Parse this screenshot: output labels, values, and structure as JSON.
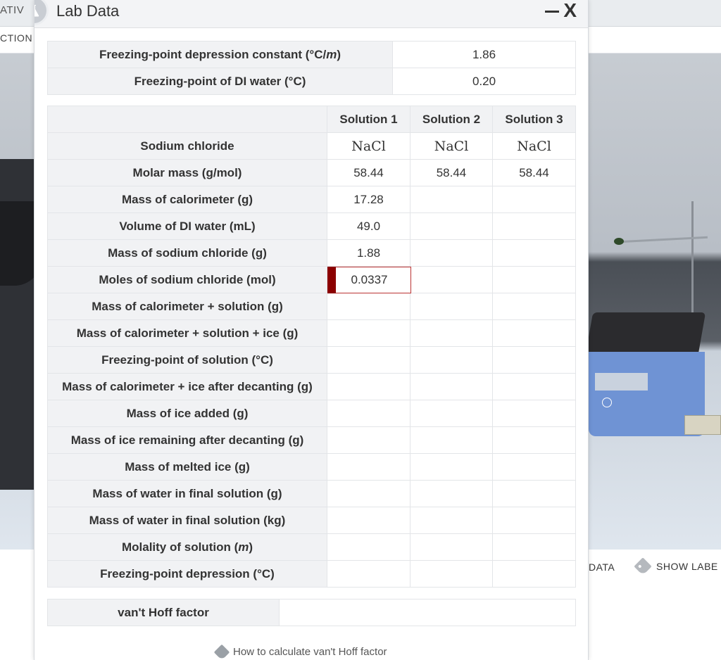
{
  "background": {
    "tab_fragment": "ATIV",
    "subtab_fragment": "CTION",
    "data_button": "DATA",
    "show_labels_button": "SHOW LABE"
  },
  "modal": {
    "title": "Lab Data",
    "close_label": "X",
    "icon": "flask-icon"
  },
  "constants": [
    {
      "label": "Freezing-point depression constant (°C/m)",
      "value": "1.86"
    },
    {
      "label": "Freezing-point of DI water (°C)",
      "value": "0.20"
    }
  ],
  "solutions_table": {
    "columns": [
      "Solution 1",
      "Solution 2",
      "Solution 3"
    ],
    "rows": [
      {
        "label": "Sodium chloride",
        "values": [
          "NaCl",
          "NaCl",
          "NaCl"
        ],
        "formula": true
      },
      {
        "label": "Molar mass (g/mol)",
        "values": [
          "58.44",
          "58.44",
          "58.44"
        ]
      },
      {
        "label": "Mass of calorimeter (g)",
        "values": [
          "17.28",
          "",
          ""
        ]
      },
      {
        "label": "Volume of DI water (mL)",
        "values": [
          "49.0",
          "",
          ""
        ]
      },
      {
        "label": "Mass of sodium chloride (g)",
        "values": [
          "1.88",
          "",
          ""
        ]
      },
      {
        "label": "Moles of sodium chloride (mol)",
        "values": [
          "0.0337",
          "",
          ""
        ],
        "active": true
      },
      {
        "label": "Mass of calorimeter + solution (g)",
        "values": [
          "",
          "",
          ""
        ]
      },
      {
        "label": "Mass of calorimeter + solution + ice (g)",
        "values": [
          "",
          "",
          ""
        ]
      },
      {
        "label": "Freezing-point of solution (°C)",
        "values": [
          "",
          "",
          ""
        ]
      },
      {
        "label": "Mass of calorimeter + ice after decanting (g)",
        "values": [
          "",
          "",
          ""
        ]
      },
      {
        "label": "Mass of ice added (g)",
        "values": [
          "",
          "",
          ""
        ]
      },
      {
        "label": "Mass of ice remaining after decanting (g)",
        "values": [
          "",
          "",
          ""
        ]
      },
      {
        "label": "Mass of melted ice (g)",
        "values": [
          "",
          "",
          ""
        ]
      },
      {
        "label": "Mass of water in final solution (g)",
        "values": [
          "",
          "",
          ""
        ]
      },
      {
        "label": "Mass of water in final solution (kg)",
        "values": [
          "",
          "",
          ""
        ]
      },
      {
        "label": "Molality of solution (m)",
        "values": [
          "",
          "",
          ""
        ]
      },
      {
        "label": "Freezing-point depression (°C)",
        "values": [
          "",
          "",
          ""
        ]
      }
    ]
  },
  "vant_hoff": {
    "label": "van't Hoff factor",
    "value": ""
  },
  "help_link": "How to calculate van't Hoff factor",
  "colors": {
    "active_marker": "#8b0000",
    "label_bg": "#f1f2f4"
  }
}
